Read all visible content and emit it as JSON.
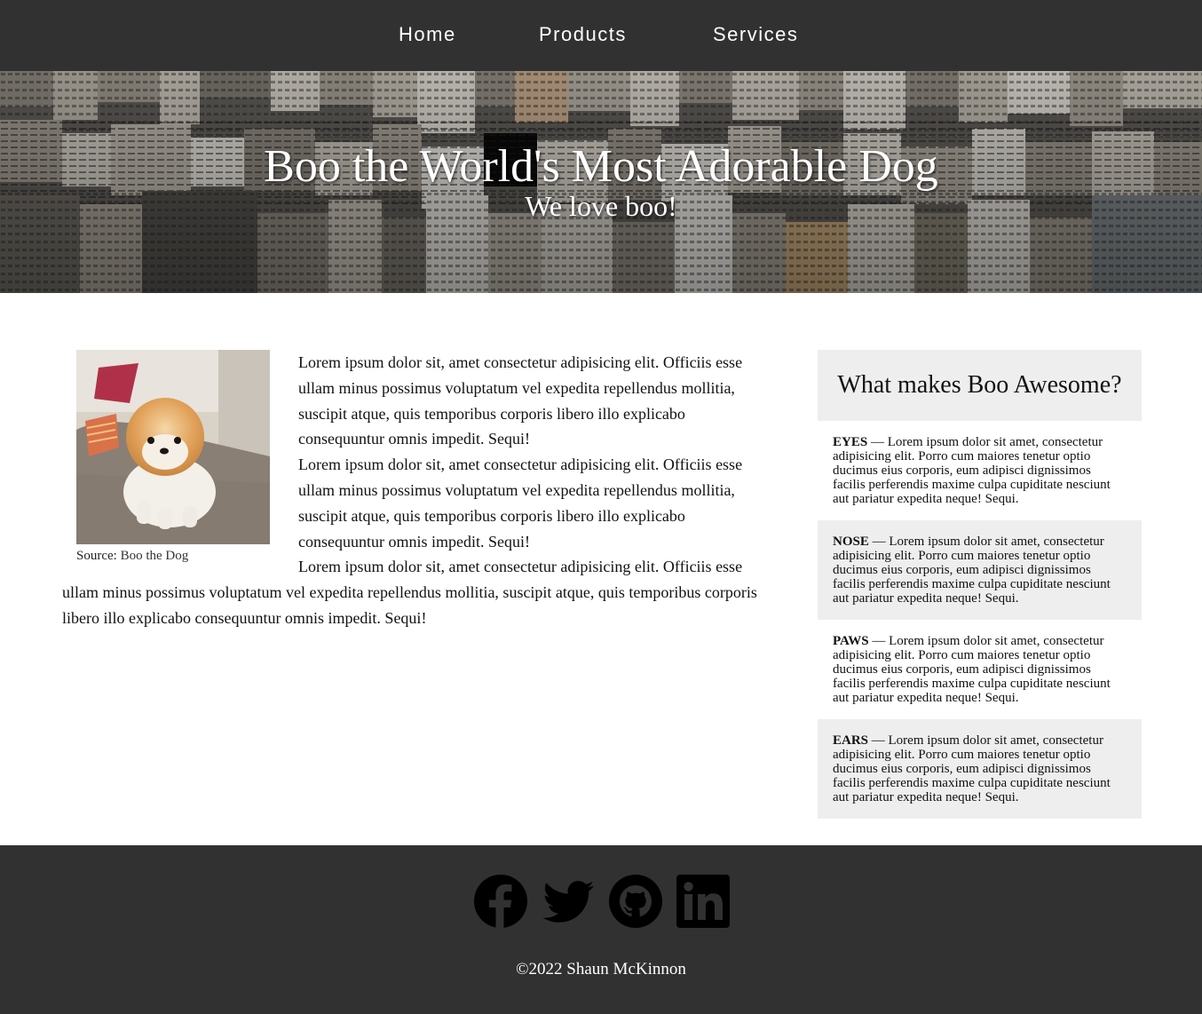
{
  "nav": {
    "items": [
      {
        "label": "Home"
      },
      {
        "label": "Products"
      },
      {
        "label": "Services"
      }
    ]
  },
  "hero": {
    "title": "Boo the World's Most Adorable Dog",
    "subtitle": "We love boo!"
  },
  "article": {
    "image_alt": "Boo the Dog",
    "caption_prefix": "Source: ",
    "caption_source": "Boo the Dog",
    "paragraphs": [
      "Lorem ipsum dolor sit, amet consectetur adipisicing elit. Officiis esse ullam minus possimus voluptatum vel expedita repellendus mollitia, suscipit atque, quis temporibus corporis libero illo explicabo consequuntur omnis impedit. Sequi!",
      "Lorem ipsum dolor sit, amet consectetur adipisicing elit. Officiis esse ullam minus possimus voluptatum vel expedita repellendus mollitia, suscipit atque, quis temporibus corporis libero illo explicabo consequuntur omnis impedit. Sequi!",
      "Lorem ipsum dolor sit, amet consectetur adipisicing elit. Officiis esse ullam minus possimus voluptatum vel expedita repellendus mollitia, suscipit atque, quis temporibus corporis libero illo explicabo consequuntur omnis impedit. Sequi!"
    ]
  },
  "sidebar": {
    "title": "What makes Boo Awesome?",
    "features": [
      {
        "name": "EYES",
        "text": " — Lorem ipsum dolor sit amet, consectetur adipisicing elit. Porro cum maiores tenetur optio ducimus eius corporis, eum adipisci dignissimos facilis perferendis maxime culpa cupiditate nesciunt aut pariatur expedita neque! Sequi."
      },
      {
        "name": "NOSE",
        "text": " — Lorem ipsum dolor sit amet, consectetur adipisicing elit. Porro cum maiores tenetur optio ducimus eius corporis, eum adipisci dignissimos facilis perferendis maxime culpa cupiditate nesciunt aut pariatur expedita neque! Sequi."
      },
      {
        "name": "PAWS",
        "text": " — Lorem ipsum dolor sit amet, consectetur adipisicing elit. Porro cum maiores tenetur optio ducimus eius corporis, eum adipisci dignissimos facilis perferendis maxime culpa cupiditate nesciunt aut pariatur expedita neque! Sequi."
      },
      {
        "name": "EARS",
        "text": " — Lorem ipsum dolor sit amet, consectetur adipisicing elit. Porro cum maiores tenetur optio ducimus eius corporis, eum adipisci dignissimos facilis perferendis maxime culpa cupiditate nesciunt aut pariatur expedita neque! Sequi."
      }
    ]
  },
  "footer": {
    "icons": [
      "facebook-icon",
      "twitter-icon",
      "github-icon",
      "linkedin-icon"
    ],
    "copyright": "©2022 Shaun McKinnon"
  },
  "colors": {
    "nav_bg": "#313131",
    "footer_bg": "#313131",
    "sidebar_shade": "#eeeeee",
    "icon_color": "#000000",
    "hero_text": "#ffffff"
  }
}
